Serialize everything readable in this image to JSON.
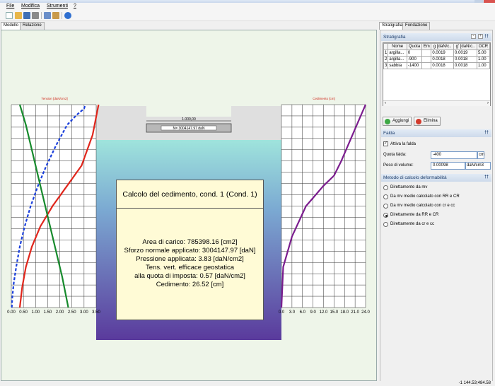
{
  "menu": {
    "file": "File",
    "modifica": "Modifica",
    "strumenti": "Strumenti",
    "help": "?"
  },
  "tabs": {
    "modello": "Modello",
    "relazione": "Relazione",
    "stratigrafia": "Stratigrafia",
    "fondazione": "Fondazione"
  },
  "canvas": {
    "left_chart_title": "Tension [daN/cm2]",
    "right_chart_title": "Cedimento [cm]",
    "foundation_width": "1.000,00",
    "foundation_load": "N= 3004147.97 daN",
    "left_axis_ticks": [
      "0.00",
      "0.50",
      "1.00",
      "1.50",
      "2.00",
      "2.50",
      "3.00",
      "3.50"
    ],
    "right_axis_ticks": [
      "0.0",
      "3.0",
      "6.0",
      "9.0",
      "12.0",
      "15.0",
      "18.0",
      "21.0",
      "24.0"
    ]
  },
  "popup": {
    "title": "Calcolo del cedimento, cond. 1 (Cond. 1)",
    "lines": [
      "Area di carico: 785398.16 [cm2]",
      "Sforzo normale applicato: 3004147.97 [daN]",
      "Pressione applicata: 3.83 [daN/cm2]",
      "Tens. vert. efficace geostatica",
      "alla quota di imposta: 0.57 [daN/cm2]",
      "Cedimento: 26.52 [cm]"
    ]
  },
  "stratigrafia": {
    "header": "Stratigrafia",
    "columns": [
      "Nome",
      "Quota",
      "Em",
      "g [daN/c..",
      "g' [daN/c..",
      "OCR"
    ],
    "rows": [
      {
        "n": "1",
        "nome": "argilla...",
        "quota": "0",
        "em": "",
        "g": "0.0019",
        "g2": "0.0019",
        "ocr": "5.00"
      },
      {
        "n": "2",
        "nome": "argilla...",
        "quota": "-900",
        "em": "",
        "g": "0.0018",
        "g2": "0.0018",
        "ocr": "1.00"
      },
      {
        "n": "3",
        "nome": "sabbia",
        "quota": "-1400",
        "em": "",
        "g": "0.0018",
        "g2": "0.0018",
        "ocr": "1.00"
      }
    ],
    "add_button": "Aggiungi",
    "delete_button": "Elimina"
  },
  "falda": {
    "header": "Falda",
    "checkbox": "Attiva la falda",
    "quota_label": "Quota falda:",
    "quota_value": "-400",
    "quota_unit": "cm",
    "peso_label": "Peso di volume:",
    "peso_value": "0.00098",
    "peso_unit": "daN/cm3"
  },
  "metodo": {
    "header": "Metodo di calcolo deformabilità",
    "options": [
      {
        "label": "Direttamente da mv",
        "selected": false
      },
      {
        "label": "Da mv medio calcolato con RR e CR",
        "selected": false
      },
      {
        "label": "Da mv medio calcolato con cr e cc",
        "selected": false
      },
      {
        "label": "Direttamente da RR e CR",
        "selected": true
      },
      {
        "label": "Direttamente da cr e cc",
        "selected": false
      }
    ]
  },
  "status": {
    "coords": "-1 144.53;484.58"
  },
  "chart_data": [
    {
      "type": "line",
      "title": "Tension [daN/cm2]",
      "xlabel": "",
      "ylabel": "",
      "xlim": [
        0,
        3.5
      ],
      "ylim": [
        0,
        1
      ],
      "series": [
        {
          "style": "dashed",
          "color": "#1a3fdc",
          "x": [
            0.02,
            0.04,
            0.1,
            0.2,
            0.35,
            0.55,
            0.8,
            1.1,
            1.45,
            1.85,
            2.3,
            2.7,
            3.0,
            3.05
          ],
          "y": [
            0.0,
            0.05,
            0.12,
            0.2,
            0.3,
            0.4,
            0.5,
            0.6,
            0.7,
            0.8,
            0.9,
            0.95,
            0.98,
            1.0
          ]
        },
        {
          "style": "solid",
          "color": "#e0261c",
          "x": [
            0.35,
            0.45,
            0.6,
            0.85,
            1.2,
            1.7,
            2.3,
            2.9,
            3.35,
            3.6
          ],
          "y": [
            0.0,
            0.1,
            0.2,
            0.3,
            0.4,
            0.5,
            0.6,
            0.7,
            0.85,
            1.0
          ]
        },
        {
          "style": "solid",
          "color": "#168a2c",
          "x": [
            2.35,
            2.1,
            1.8,
            1.5,
            1.2,
            0.9,
            0.6,
            0.35
          ],
          "y": [
            0.0,
            0.15,
            0.3,
            0.45,
            0.6,
            0.75,
            0.9,
            1.0
          ]
        }
      ]
    },
    {
      "type": "line",
      "title": "Cedimento [cm]",
      "xlabel": "",
      "ylabel": "",
      "xlim": [
        0,
        24
      ],
      "ylim": [
        0,
        1
      ],
      "series": [
        {
          "style": "solid",
          "color": "#7b1d8e",
          "x": [
            0,
            0.5,
            3,
            7,
            12,
            15,
            17,
            19,
            21,
            23,
            24
          ],
          "y": [
            0.0,
            0.2,
            0.35,
            0.5,
            0.6,
            0.65,
            0.72,
            0.8,
            0.88,
            0.96,
            1.0
          ]
        }
      ]
    }
  ]
}
